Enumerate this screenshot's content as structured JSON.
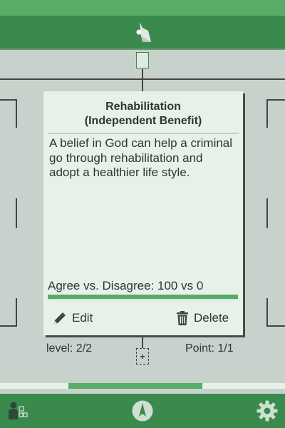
{
  "card": {
    "title_line1": "Rehabilitation",
    "title_line2": "(Independent Benefit)",
    "body": "A belief in God can help a criminal go through rehabilitation and adopt a healthier life style.",
    "vote_label": "Agree vs. Disagree: 100 vs 0",
    "agree_fraction": 1.0,
    "edit_label": "Edit",
    "delete_label": "Delete"
  },
  "tree": {
    "level_label": "level: 2/2",
    "point_label": "Point: 1/1",
    "add_child_symbol": "+"
  },
  "pager": {
    "active_start_fraction": 0.24,
    "active_width_fraction": 0.47
  },
  "icons": {
    "header": "app-logo-icon",
    "edit": "pencil-icon",
    "delete": "trash-icon",
    "nav_left": "tree-view-icon",
    "nav_center": "compass-icon",
    "nav_right": "gear-icon"
  },
  "colors": {
    "accent": "#57ac66",
    "header": "#3b8a4d",
    "card": "#e6f2e9",
    "background": "#c8d2cc"
  }
}
